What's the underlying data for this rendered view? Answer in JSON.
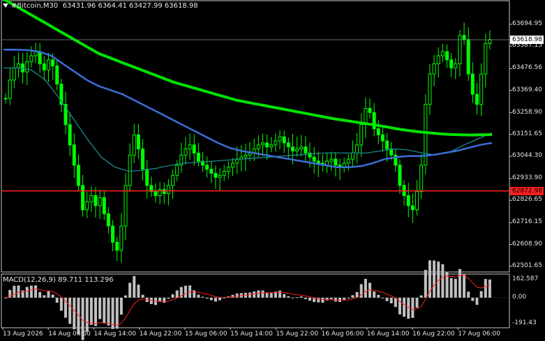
{
  "header": {
    "symbol": "#Bitcoin,M30",
    "ohlc": "63431.96 6364.41 63427.99 63618.98"
  },
  "indicator": {
    "label": "MACD(12,26,9) 89.711 113.296"
  },
  "colors": {
    "background": "#000000",
    "candles": "#00ff00",
    "ma_slow": "#00e400",
    "ma_mid": "#3b6fd8",
    "ma_fast": "#1a8a8a",
    "level_line": "#ff2020",
    "macd_hist": "#c0c0c0",
    "macd_signal": "#ff2020",
    "grid": "#404040"
  },
  "price_axis": {
    "ticks": [
      "63694.95",
      "63587.15",
      "63476.56",
      "63369.40",
      "63258.90",
      "63151.65",
      "63044.30",
      "62933.90",
      "62826.65",
      "62716.15",
      "62608.90",
      "62501.65"
    ]
  },
  "current_price": "63618.98",
  "level_price": "62872.98",
  "macd_axis": {
    "ticks": [
      "162.587",
      "0.00",
      "-191.43"
    ]
  },
  "time_axis": {
    "labels": [
      "13 Aug 2026",
      "14 Aug 06:00",
      "14 Aug 14:00",
      "14 Aug 22:00",
      "15 Aug 06:00",
      "15 Aug 14:00",
      "15 Aug 22:00",
      "16 Aug 06:00",
      "16 Aug 14:00",
      "16 Aug 22:00",
      "17 Aug 06:00"
    ]
  },
  "chart_data": {
    "type": "line",
    "symbol": "#Bitcoin",
    "timeframe": "M30",
    "y_range": [
      62480,
      63760
    ],
    "close_series": [
      63330,
      63420,
      63480,
      63500,
      63460,
      63510,
      63540,
      63560,
      63500,
      63470,
      63520,
      63490,
      63400,
      63300,
      63200,
      63100,
      63000,
      62900,
      62780,
      62820,
      62850,
      62800,
      62840,
      62760,
      62700,
      62620,
      62580,
      62700,
      62900,
      63050,
      63150,
      63080,
      62980,
      62900,
      62870,
      62850,
      62880,
      62860,
      62900,
      62950,
      63000,
      63050,
      63080,
      63100,
      63060,
      63020,
      63000,
      62980,
      62960,
      62940,
      62950,
      62970,
      62990,
      63010,
      63030,
      63040,
      63050,
      63060,
      63080,
      63100,
      63110,
      63090,
      63100,
      63120,
      63140,
      63110,
      63090,
      63070,
      63080,
      63090,
      63060,
      63040,
      63020,
      63010,
      63000,
      63020,
      63030,
      63000,
      62990,
      63010,
      63030,
      63060,
      63100,
      63200,
      63280,
      63260,
      63180,
      63150,
      63120,
      63080,
      63050,
      63000,
      62900,
      62850,
      62800,
      62780,
      62870,
      63000,
      63300,
      63450,
      63500,
      63540,
      63560,
      63520,
      63480,
      63500,
      63640,
      63620,
      63450,
      63350,
      63300,
      63450,
      63600,
      63620
    ],
    "ma_slow": [
      63820,
      63790,
      63760,
      63730,
      63700,
      63670,
      63640,
      63610,
      63580,
      63550,
      63530,
      63510,
      63490,
      63470,
      63450,
      63430,
      63410,
      63395,
      63380,
      63365,
      63350,
      63335,
      63320,
      63310,
      63300,
      63290,
      63280,
      63270,
      63260,
      63250,
      63240,
      63230,
      63222,
      63214,
      63206,
      63198,
      63190,
      63180,
      63172,
      63165,
      63160,
      63155,
      63152,
      63150,
      63149,
      63150,
      63151
    ],
    "ma_mid": [
      63570,
      63570,
      63568,
      63560,
      63540,
      63500,
      63460,
      63420,
      63390,
      63370,
      63350,
      63320,
      63290,
      63260,
      63230,
      63200,
      63170,
      63140,
      63110,
      63085,
      63070,
      63060,
      63050,
      63040,
      63030,
      63020,
      63010,
      63000,
      62990,
      62990,
      62995,
      63010,
      63030,
      63040,
      63045,
      63045,
      63050,
      63060,
      63070,
      63085,
      63100,
      63110
    ],
    "ma_fast": [
      63480,
      63480,
      63470,
      63420,
      63330,
      63230,
      63130,
      63040,
      62990,
      62970,
      62975,
      62985,
      63000,
      63010,
      63015,
      63020,
      63025,
      63030,
      63035,
      63040,
      63045,
      63050,
      63055,
      63060,
      63060,
      63060,
      63060,
      63070,
      63080,
      63075,
      63060,
      63050,
      63065,
      63100,
      63130,
      63160
    ]
  }
}
